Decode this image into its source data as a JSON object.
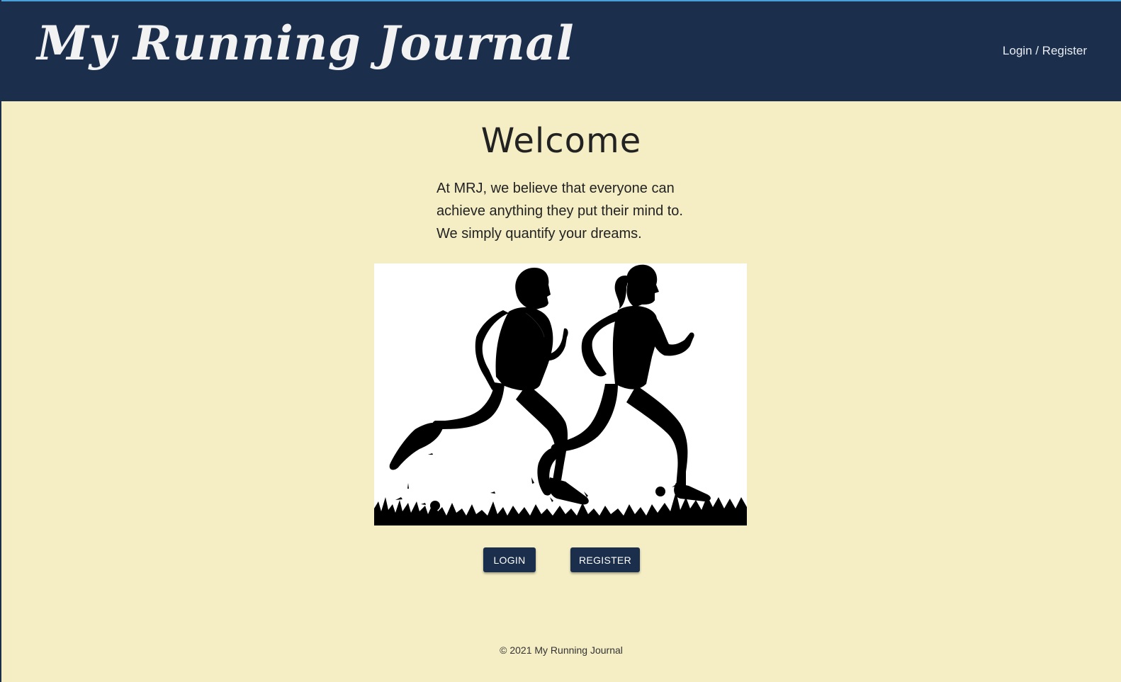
{
  "header": {
    "brand": "My Running Journal",
    "nav_link": "Login / Register"
  },
  "main": {
    "title": "Welcome",
    "intro": "At MRJ, we believe that everyone can achieve anything they put their mind to. We simply quantify your dreams.",
    "hero_image": "runners-silhouette",
    "buttons": {
      "login": "LOGIN",
      "register": "REGISTER"
    }
  },
  "footer": {
    "copyright": "© 2021 My Running Journal"
  },
  "colors": {
    "header_bg": "#1b2e4b",
    "page_bg": "#f5eec5",
    "button_bg": "#1b2e4b",
    "text": "#222222"
  }
}
